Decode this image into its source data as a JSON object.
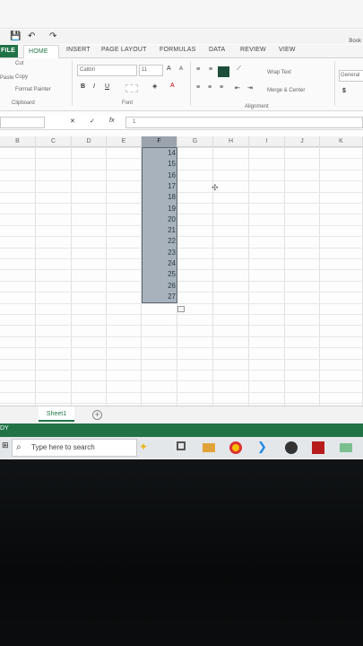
{
  "quick_access": {
    "save": "💾",
    "undo": "↶",
    "redo": "↷"
  },
  "window": {
    "title": "Book"
  },
  "tabs": [
    "FILE",
    "HOME",
    "INSERT",
    "PAGE LAYOUT",
    "FORMULAS",
    "DATA",
    "REVIEW",
    "VIEW"
  ],
  "ribbon": {
    "cut": "Cut",
    "copy": "Copy",
    "format_painter": "Format Painter",
    "paste": "Paste",
    "clipboard_group": "Clipboard",
    "font_name": "Calibri",
    "font_size": "11",
    "font_group": "Font",
    "wrap_text": "Wrap Text",
    "merge_center": "Merge & Center",
    "alignment_group": "Alignment",
    "number_format": "General",
    "currency": "$",
    "bold": "B",
    "italic": "I",
    "underline": "U",
    "grow_font": "A",
    "shrink_font": "A"
  },
  "formula_bar": {
    "cancel": "✕",
    "confirm": "✓",
    "fx": "fx",
    "value": "1"
  },
  "columns": [
    "B",
    "C",
    "D",
    "E",
    "F",
    "G",
    "H",
    "I",
    "J",
    "K"
  ],
  "selected_column": "F",
  "rows": [
    "14",
    "15",
    "16",
    "17",
    "18",
    "19",
    "20",
    "21",
    "22",
    "23",
    "24",
    "25",
    "26",
    "27"
  ],
  "sheet": {
    "name": "Sheet1",
    "add": "+"
  },
  "status": {
    "mode": "DY"
  },
  "taskbar": {
    "search_placeholder": "Type here to search"
  },
  "colors": {
    "excel_green": "#217346",
    "selection": "#a7b2bc"
  }
}
